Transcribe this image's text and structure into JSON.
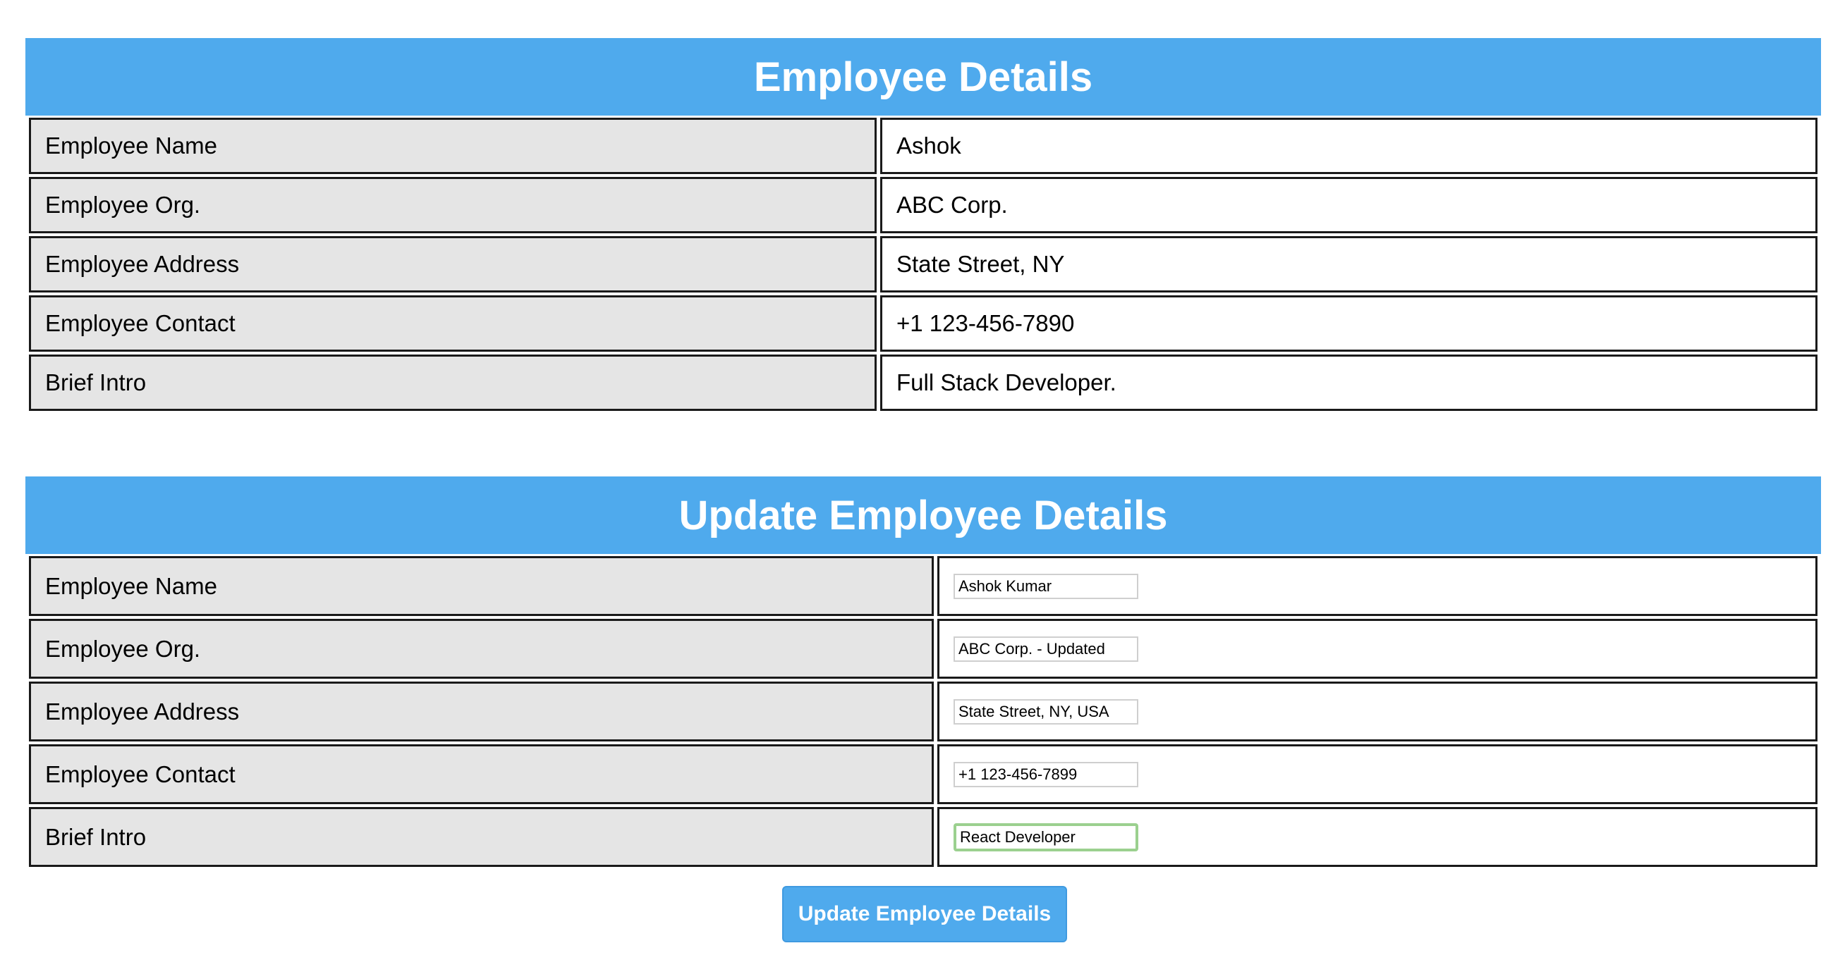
{
  "employee_details": {
    "title": "Employee Details",
    "rows": [
      {
        "label": "Employee Name",
        "value": "Ashok"
      },
      {
        "label": "Employee Org.",
        "value": "ABC Corp."
      },
      {
        "label": "Employee Address",
        "value": "State Street, NY"
      },
      {
        "label": "Employee Contact",
        "value": "+1 123-456-7890"
      },
      {
        "label": "Brief Intro",
        "value": "Full Stack Developer."
      }
    ]
  },
  "update_form": {
    "title": "Update Employee Details",
    "rows": [
      {
        "label": "Employee Name",
        "value": "Ashok Kumar"
      },
      {
        "label": "Employee Org.",
        "value": "ABC Corp. - Updated"
      },
      {
        "label": "Employee Address",
        "value": "State Street, NY, USA"
      },
      {
        "label": "Employee Contact",
        "value": "+1 123-456-7899"
      },
      {
        "label": "Brief Intro",
        "value": "React Developer"
      }
    ],
    "submit_label": "Update Employee Details"
  },
  "colors": {
    "header_bg": "#4faaed",
    "label_cell_bg": "#e5e5e5",
    "focus_ring": "#9bd08f"
  }
}
